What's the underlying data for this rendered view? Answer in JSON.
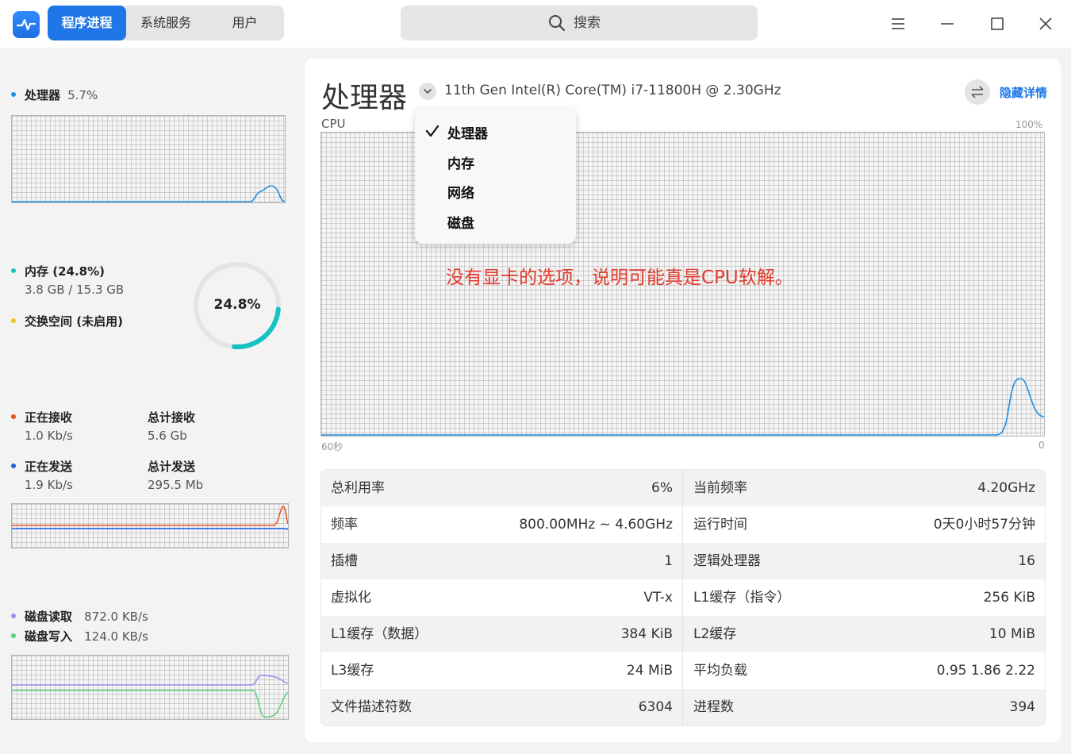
{
  "titlebar": {
    "tabs": [
      {
        "label": "程序进程",
        "active": true
      },
      {
        "label": "系统服务",
        "active": false
      },
      {
        "label": "用户",
        "active": false
      }
    ],
    "search_placeholder": "搜索"
  },
  "sidebar": {
    "cpu": {
      "label": "处理器",
      "value": "5.7%",
      "color": "#1f8fe0"
    },
    "memory": {
      "label": "内存 (24.8%)",
      "usage": "3.8 GB / 15.3 GB",
      "percent_text": "24.8%",
      "percent": 24.8,
      "color": "#14c2c2"
    },
    "swap": {
      "label": "交换空间 (未启用)",
      "color": "#f0c419"
    },
    "network": {
      "recv_label": "正在接收",
      "recv_value": "1.0 Kb/s",
      "recv_color": "#e0541f",
      "total_recv_label": "总计接收",
      "total_recv_value": "5.6 Gb",
      "send_label": "正在发送",
      "send_value": "1.9 Kb/s",
      "send_color": "#1f5ee0",
      "total_send_label": "总计发送",
      "total_send_value": "295.5 Mb"
    },
    "disk": {
      "read_label": "磁盘读取",
      "read_value": "872.0 KB/s",
      "read_color": "#9d8cf0",
      "write_label": "磁盘写入",
      "write_value": "124.0 KB/s",
      "write_color": "#5cd07a"
    }
  },
  "main": {
    "title": "处理器",
    "cpu_model": "11th Gen Intel(R) Core(TM) i7-11800H @ 2.30GHz",
    "hide_details": "隐藏详情",
    "graph_label": "CPU",
    "graph_max": "100%",
    "graph_time": "60秒",
    "graph_min": "0",
    "dropdown": [
      {
        "label": "处理器",
        "checked": true
      },
      {
        "label": "内存",
        "checked": false
      },
      {
        "label": "网络",
        "checked": false
      },
      {
        "label": "磁盘",
        "checked": false
      }
    ],
    "annotation": "没有显卡的选项，说明可能真是CPU软解。",
    "details": [
      {
        "left_label": "总利用率",
        "left_value": "6%",
        "right_label": "当前频率",
        "right_value": "4.20GHz"
      },
      {
        "left_label": "频率",
        "left_value": "800.00MHz ~ 4.60GHz",
        "right_label": "运行时间",
        "right_value": "0天0小时57分钟"
      },
      {
        "left_label": "插槽",
        "left_value": "1",
        "right_label": "逻辑处理器",
        "right_value": "16"
      },
      {
        "left_label": "虚拟化",
        "left_value": "VT-x",
        "right_label": "L1缓存（指令）",
        "right_value": "256 KiB"
      },
      {
        "left_label": "L1缓存（数据）",
        "left_value": "384 KiB",
        "right_label": "L2缓存",
        "right_value": "10 MiB"
      },
      {
        "left_label": "L3缓存",
        "left_value": "24 MiB",
        "right_label": "平均负载",
        "right_value": "0.95 1.86 2.22"
      },
      {
        "left_label": "文件描述符数",
        "left_value": "6304",
        "right_label": "进程数",
        "right_value": "394"
      }
    ]
  }
}
